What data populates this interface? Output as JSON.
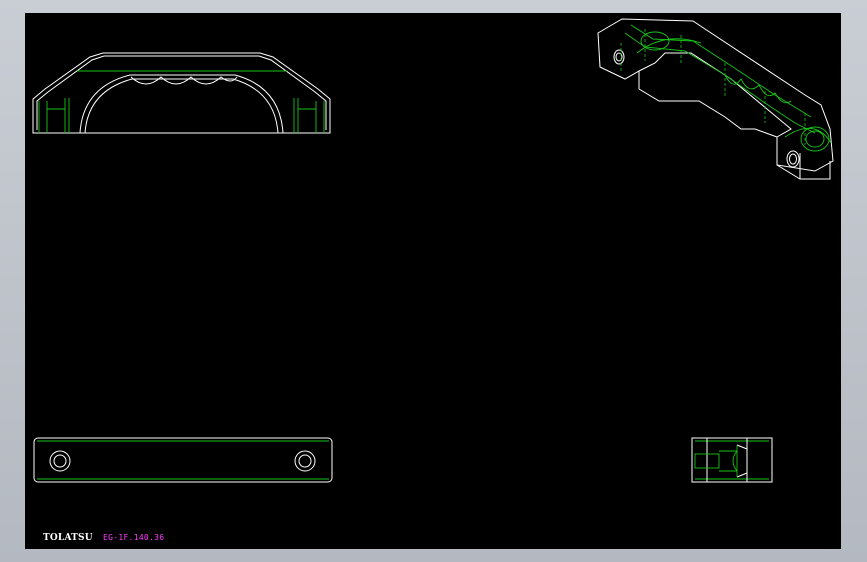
{
  "drawing": {
    "brand_label": "TOLATSU",
    "part_number": "EG-1F.140.36",
    "colors": {
      "background": "#000000",
      "frame": "#b9bec6",
      "edge": "#ffffff",
      "hidden_edge": "#19c219",
      "part_label": "#ff3cff"
    },
    "views": [
      "front-view",
      "isometric-view",
      "top-view",
      "side-view"
    ]
  }
}
